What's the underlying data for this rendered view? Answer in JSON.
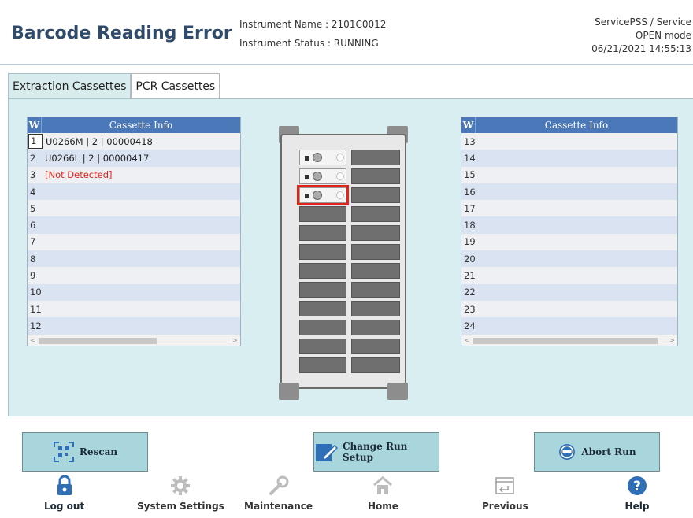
{
  "header": {
    "title": "Barcode Reading Error",
    "instrument_name": "Instrument Name : 2101C0012",
    "instrument_status": "Instrument Status : RUNNING",
    "user": "ServicePSS / Service",
    "mode": "OPEN mode",
    "datetime": "06/21/2021 14:55:13"
  },
  "tabs": [
    {
      "label": "Extraction Cassettes"
    },
    {
      "label": "PCR Cassettes"
    }
  ],
  "active_tab": "PCR Cassettes",
  "left_table": {
    "col_w": "W",
    "col_info": "Cassette Info",
    "rows": [
      {
        "n": "1",
        "info": "U0266M | 2 | 00000418"
      },
      {
        "n": "2",
        "info": "U0266L | 2 | 00000417"
      },
      {
        "n": "3",
        "info": "[Not Detected]"
      },
      {
        "n": "4",
        "info": ""
      },
      {
        "n": "5",
        "info": ""
      },
      {
        "n": "6",
        "info": ""
      },
      {
        "n": "7",
        "info": ""
      },
      {
        "n": "8",
        "info": ""
      },
      {
        "n": "9",
        "info": ""
      },
      {
        "n": "10",
        "info": ""
      },
      {
        "n": "11",
        "info": ""
      },
      {
        "n": "12",
        "info": ""
      }
    ]
  },
  "right_table": {
    "col_w": "W",
    "col_info": "Cassette Info",
    "rows": [
      {
        "n": "13",
        "info": ""
      },
      {
        "n": "14",
        "info": ""
      },
      {
        "n": "15",
        "info": ""
      },
      {
        "n": "16",
        "info": ""
      },
      {
        "n": "17",
        "info": ""
      },
      {
        "n": "18",
        "info": ""
      },
      {
        "n": "19",
        "info": ""
      },
      {
        "n": "20",
        "info": ""
      },
      {
        "n": "21",
        "info": ""
      },
      {
        "n": "22",
        "info": ""
      },
      {
        "n": "23",
        "info": ""
      },
      {
        "n": "24",
        "info": ""
      }
    ]
  },
  "actions": {
    "rescan": "Rescan",
    "change_run_setup": "Change Run Setup",
    "abort_run": "Abort Run"
  },
  "nav": {
    "logout": "Log out",
    "system_settings": "System Settings",
    "maintenance": "Maintenance",
    "home": "Home",
    "previous": "Previous",
    "help": "Help"
  },
  "colors": {
    "title": "#2f4a6a",
    "table_header": "#4a78b8",
    "error": "#e0241b",
    "button_bg": "#a9d6dd",
    "panel_bg": "#d9eef0"
  }
}
